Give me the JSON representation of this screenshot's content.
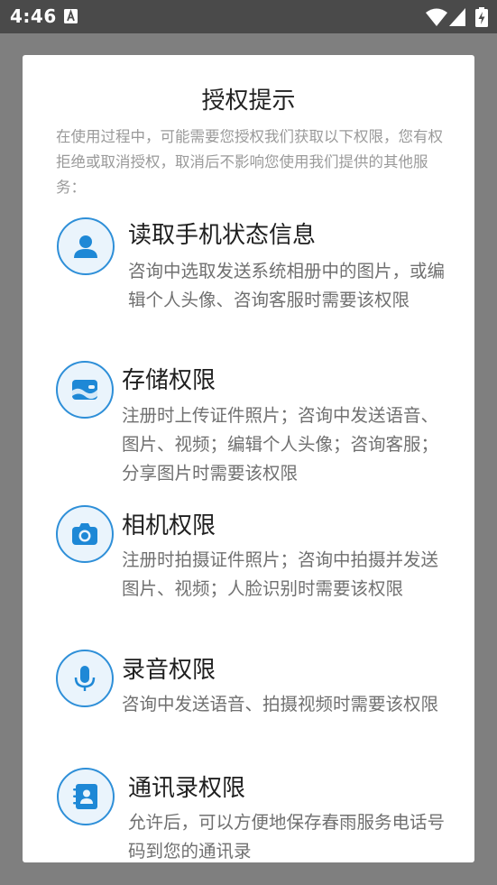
{
  "status_bar": {
    "time": "4:46",
    "icons": [
      "notification-a-icon",
      "wifi-icon",
      "signal-icon",
      "battery-charging-icon"
    ]
  },
  "dialog": {
    "title": "授权提示",
    "intro": "在使用过程中，可能需要您授权我们获取以下权限，您有权拒绝或取消授权，取消后不影响您使用我们提供的其他服务：",
    "permissions": [
      {
        "icon": "person-icon",
        "title": "读取手机状态信息",
        "description": "咨询中选取发送系统相册中的图片，或编辑个人头像、咨询客服时需要该权限"
      },
      {
        "icon": "wallet-storage-icon",
        "title": "存储权限",
        "description": "注册时上传证件照片；咨询中发送语音、图片、视频；编辑个人头像；咨询客服；分享图片时需要该权限"
      },
      {
        "icon": "camera-icon",
        "title": "相机权限",
        "description": "注册时拍摄证件照片；咨询中拍摄并发送图片、视频；人脸识别时需要该权限"
      },
      {
        "icon": "microphone-icon",
        "title": "录音权限",
        "description": "咨询中发送语音、拍摄视频时需要该权限"
      },
      {
        "icon": "contacts-book-icon",
        "title": "通讯录权限",
        "description": "允许后，可以方便地保存春雨服务电话号码到您的通讯录"
      }
    ]
  },
  "colors": {
    "accent": "#2e8fd8",
    "icon_fill": "#1e88d6",
    "icon_bg": "#eaf4fc",
    "status_bar": "#4a4a4a",
    "scrim": "#7f7f7f"
  }
}
